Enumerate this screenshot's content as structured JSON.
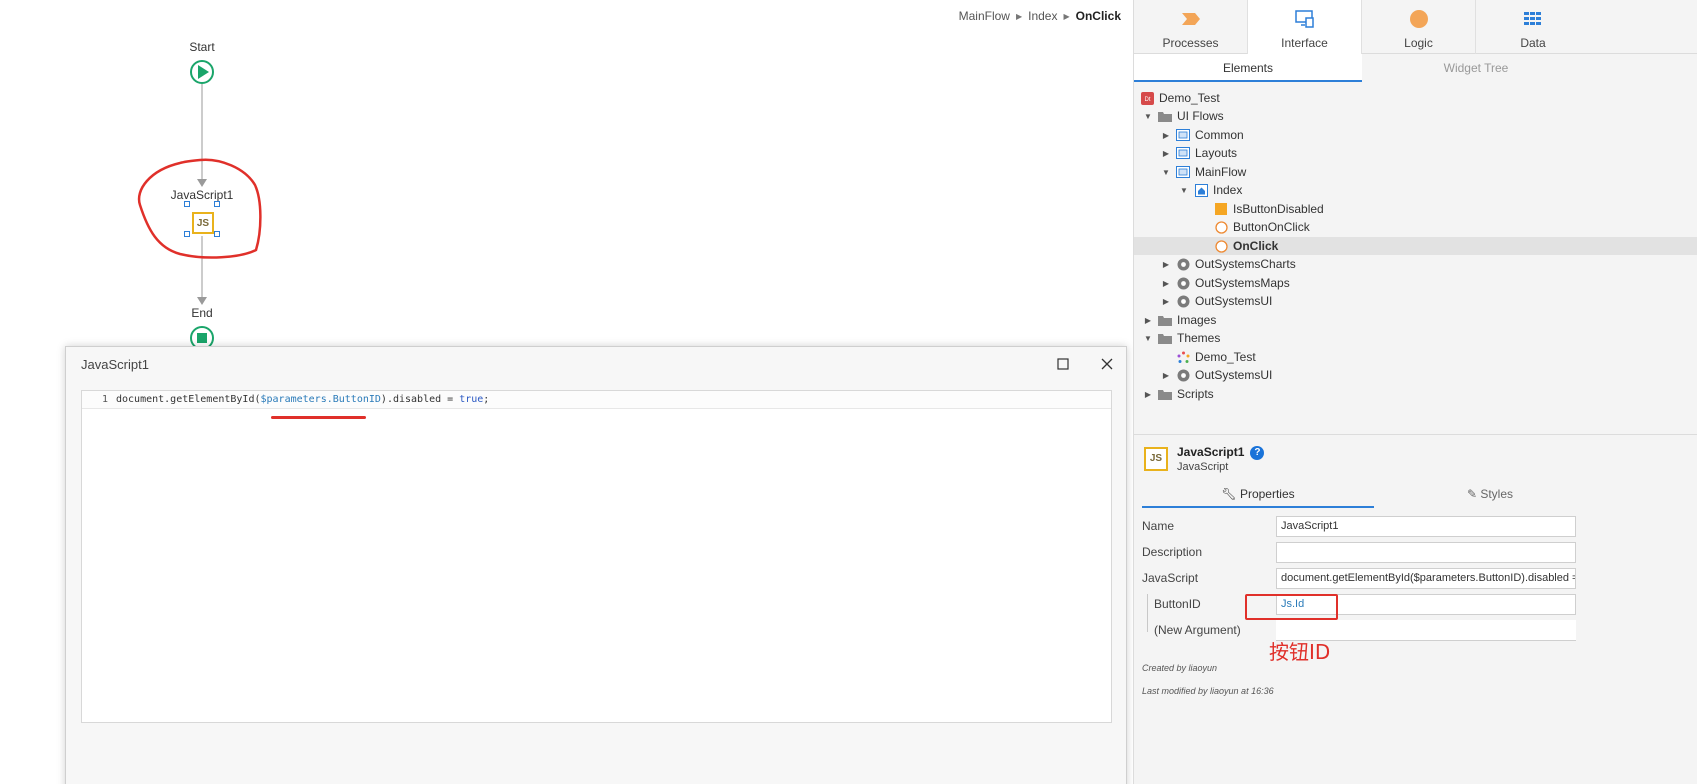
{
  "breadcrumb": {
    "items": [
      "MainFlow",
      "Index"
    ],
    "current": "OnClick"
  },
  "flow": {
    "start_label": "Start",
    "action_label": "JavaScript1",
    "action_icon_text": "JS",
    "end_label": "End"
  },
  "editor": {
    "title": "JavaScript1",
    "line_number": "1",
    "code_prefix": "document.getElementById(",
    "code_param": "$parameters.ButtonID",
    "code_middle": ").disabled = ",
    "code_keyword": "true",
    "code_suffix": ";"
  },
  "top_tabs": [
    {
      "label": "Processes",
      "icon": "processes-icon"
    },
    {
      "label": "Interface",
      "icon": "interface-icon",
      "active": true
    },
    {
      "label": "Logic",
      "icon": "logic-icon"
    },
    {
      "label": "Data",
      "icon": "data-icon"
    }
  ],
  "sub_tabs": [
    {
      "label": "Elements",
      "active": true
    },
    {
      "label": "Widget Tree"
    }
  ],
  "tree": [
    {
      "label": "Demo_Test",
      "icon": "module-icon"
    },
    {
      "label": "UI Flows",
      "icon": "folder-icon"
    },
    {
      "label": "Common",
      "icon": "flow-icon"
    },
    {
      "label": "Layouts",
      "icon": "flow-icon"
    },
    {
      "label": "MainFlow",
      "icon": "flow-icon"
    },
    {
      "label": "Index",
      "icon": "screen-icon"
    },
    {
      "label": "IsButtonDisabled",
      "icon": "local-variable-icon"
    },
    {
      "label": "ButtonOnClick",
      "icon": "client-action-icon"
    },
    {
      "label": "OnClick",
      "icon": "client-action-icon"
    },
    {
      "label": "OutSystemsCharts",
      "icon": "dependency-icon"
    },
    {
      "label": "OutSystemsMaps",
      "icon": "dependency-icon"
    },
    {
      "label": "OutSystemsUI",
      "icon": "dependency-icon"
    },
    {
      "label": "Images",
      "icon": "folder-icon"
    },
    {
      "label": "Themes",
      "icon": "folder-icon"
    },
    {
      "label": "Demo_Test",
      "icon": "theme-icon"
    },
    {
      "label": "OutSystemsUI",
      "icon": "dependency-icon"
    },
    {
      "label": "Scripts",
      "icon": "folder-icon"
    }
  ],
  "element": {
    "icon_text": "JS",
    "name": "JavaScript1",
    "type": "JavaScript",
    "help": "?"
  },
  "prop_tabs": {
    "properties": "Properties",
    "styles": "Styles"
  },
  "properties": {
    "name_label": "Name",
    "name_value": "JavaScript1",
    "description_label": "Description",
    "description_value": "",
    "javascript_label": "JavaScript",
    "javascript_value": "document.getElementById($parameters.ButtonID).disabled = true;",
    "buttonid_label": "ButtonID",
    "buttonid_value": "Js.Id",
    "new_argument_label": "(New Argument)",
    "new_argument_value": ""
  },
  "footer": {
    "created_by": "Created by liaoyun",
    "modified_by": "Last modified by liaoyun at 16:36"
  },
  "annotation": {
    "text": "按钮ID",
    "color": "#e0302a"
  }
}
